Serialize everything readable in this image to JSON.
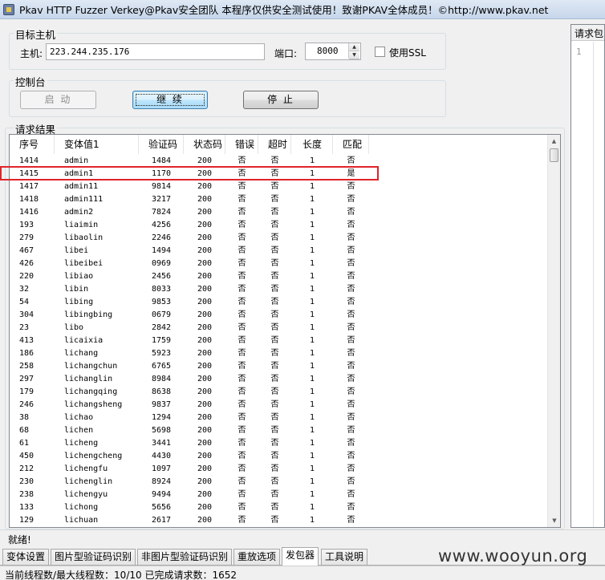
{
  "window": {
    "title": "Pkav HTTP Fuzzer   Verkey@Pkav安全团队  本程序仅供安全测试使用！致谢PKAV全体成员！©http://www.pkav.net"
  },
  "target_host": {
    "group_label": "目标主机",
    "host_label": "主机:",
    "host_value": "223.244.235.176",
    "port_label": "端口:",
    "port_value": "8000",
    "ssl_label": "使用SSL",
    "ssl_checked": false
  },
  "console": {
    "group_label": "控制台",
    "start_label": "启 动",
    "continue_label": "继 续",
    "stop_label": "停 止"
  },
  "results": {
    "group_label": "请求结果",
    "columns": [
      "序号",
      "变体值1",
      "验证码",
      "状态码",
      "错误",
      "超时",
      "长度",
      "匹配"
    ],
    "rows": [
      [
        "1414",
        "admin",
        "1484",
        "200",
        "否",
        "否",
        "1",
        "否"
      ],
      [
        "1415",
        "admin1",
        "1170",
        "200",
        "否",
        "否",
        "1",
        "是"
      ],
      [
        "1417",
        "admin11",
        "9814",
        "200",
        "否",
        "否",
        "1",
        "否"
      ],
      [
        "1418",
        "admin111",
        "3217",
        "200",
        "否",
        "否",
        "1",
        "否"
      ],
      [
        "1416",
        "admin2",
        "7824",
        "200",
        "否",
        "否",
        "1",
        "否"
      ],
      [
        "193",
        "liaimin",
        "4256",
        "200",
        "否",
        "否",
        "1",
        "否"
      ],
      [
        "279",
        "libaolin",
        "2246",
        "200",
        "否",
        "否",
        "1",
        "否"
      ],
      [
        "467",
        "libei",
        "1494",
        "200",
        "否",
        "否",
        "1",
        "否"
      ],
      [
        "426",
        "libeibei",
        "0969",
        "200",
        "否",
        "否",
        "1",
        "否"
      ],
      [
        "220",
        "libiao",
        "2456",
        "200",
        "否",
        "否",
        "1",
        "否"
      ],
      [
        "32",
        "libin",
        "8033",
        "200",
        "否",
        "否",
        "1",
        "否"
      ],
      [
        "54",
        "libing",
        "9853",
        "200",
        "否",
        "否",
        "1",
        "否"
      ],
      [
        "304",
        "libingbing",
        "0679",
        "200",
        "否",
        "否",
        "1",
        "否"
      ],
      [
        "23",
        "libo",
        "2842",
        "200",
        "否",
        "否",
        "1",
        "否"
      ],
      [
        "413",
        "licaixia",
        "1759",
        "200",
        "否",
        "否",
        "1",
        "否"
      ],
      [
        "186",
        "lichang",
        "5923",
        "200",
        "否",
        "否",
        "1",
        "否"
      ],
      [
        "258",
        "lichangchun",
        "6765",
        "200",
        "否",
        "否",
        "1",
        "否"
      ],
      [
        "297",
        "lichanglin",
        "8984",
        "200",
        "否",
        "否",
        "1",
        "否"
      ],
      [
        "179",
        "lichangqing",
        "8638",
        "200",
        "否",
        "否",
        "1",
        "否"
      ],
      [
        "246",
        "lichangsheng",
        "9837",
        "200",
        "否",
        "否",
        "1",
        "否"
      ],
      [
        "38",
        "lichao",
        "1294",
        "200",
        "否",
        "否",
        "1",
        "否"
      ],
      [
        "68",
        "lichen",
        "5698",
        "200",
        "否",
        "否",
        "1",
        "否"
      ],
      [
        "61",
        "licheng",
        "3441",
        "200",
        "否",
        "否",
        "1",
        "否"
      ],
      [
        "450",
        "lichengcheng",
        "4430",
        "200",
        "否",
        "否",
        "1",
        "否"
      ],
      [
        "212",
        "lichengfu",
        "1097",
        "200",
        "否",
        "否",
        "1",
        "否"
      ],
      [
        "230",
        "lichenglin",
        "8924",
        "200",
        "否",
        "否",
        "1",
        "否"
      ],
      [
        "238",
        "lichengyu",
        "9494",
        "200",
        "否",
        "否",
        "1",
        "否"
      ],
      [
        "133",
        "lichong",
        "5656",
        "200",
        "否",
        "否",
        "1",
        "否"
      ],
      [
        "129",
        "lichuan",
        "2617",
        "200",
        "否",
        "否",
        "1",
        "否"
      ]
    ]
  },
  "right_panel": {
    "tab_label": "请求包",
    "line_number": "1"
  },
  "status": {
    "message": "就绪!"
  },
  "tabs": [
    "变体设置",
    "图片型验证码识别",
    "非图片型验证码识别",
    "重放选项",
    "发包器",
    "工具说明"
  ],
  "active_tab": 4,
  "watermark": "www.wooyun.org",
  "footer": {
    "text": "当前线程数/最大线程数：10/10  已完成请求数：1652"
  },
  "colors": {
    "highlight_border": "#e0242a",
    "titlebar": "#c6d6ea"
  }
}
